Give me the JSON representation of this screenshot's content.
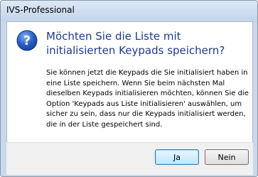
{
  "window": {
    "title": "IVS-Professional"
  },
  "dialog": {
    "icon": "question-icon",
    "main_instruction": "Möchten Sie die Liste mit initialisierten Keypads speichern?",
    "body_lines": [
      "Sie können jetzt die Keypads die Sie initialisiert haben in",
      "eine Liste speichern. Wenn Sie beim nächsten Mal",
      "dieselben Keypads initialisieren möchten, können Sie die",
      "Option 'Keypads aus Liste initialisieren' auswählen, um",
      "sicher zu sein, dass nur die Keypads initialisiert werden,",
      "die in der Liste gespeichert sind."
    ]
  },
  "buttons": {
    "yes_label": "Ja",
    "no_label": "Nein"
  },
  "colors": {
    "instruction_text": "#1e3c8c",
    "icon_blue": "#2a5fc9",
    "title_bar": "#c9d9ec"
  }
}
